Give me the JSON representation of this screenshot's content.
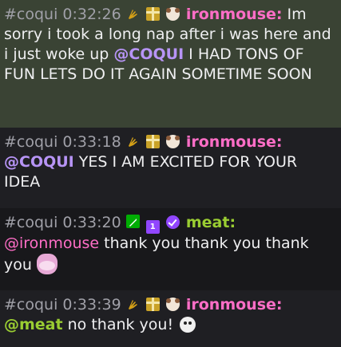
{
  "messages": [
    {
      "channel": "#coqui",
      "time": "0:32:26",
      "badges": [
        "hand-wave-icon",
        "gift-icon",
        "mouse-icon"
      ],
      "username": "ironmouse",
      "separator": ":",
      "text_before": " Im sorry i took a long nap after i was here and i just woke up ",
      "mention": "@COQUI",
      "text_after": " I HAD TONS OF FUN LETS DO IT AGAIN SOMETIME SOON",
      "highlight_color": "#3a4334"
    },
    {
      "channel": "#coqui",
      "time": "0:33:18",
      "badges": [
        "hand-wave-icon",
        "gift-icon",
        "mouse-icon"
      ],
      "username": "ironmouse",
      "separator": ":",
      "mention": "@COQUI",
      "text_after": " YES I AM EXCITED FOR YOUR IDEA"
    },
    {
      "channel": "#coqui",
      "time": "0:33:20",
      "badges": [
        "moderator-sword-icon",
        "subscriber-icon",
        "verified-icon"
      ],
      "sub_badge_text": "1",
      "username": "meat",
      "separator": ":",
      "mention": "@ironmouse",
      "text_after": " thank you thank you thank you",
      "emote": "mouse-emote"
    },
    {
      "channel": "#coqui",
      "time": "0:33:39",
      "badges": [
        "hand-wave-icon",
        "gift-icon",
        "mouse-icon"
      ],
      "username": "ironmouse",
      "separator": ":",
      "mention": "@meat",
      "text_after": " no thank you!",
      "emote": "face-emote"
    }
  ],
  "colors": {
    "username_ironmouse": "#ff6ec7",
    "username_meat": "#9acd32",
    "mention": "#b794f6",
    "timestamp": "#a0a0a8"
  }
}
